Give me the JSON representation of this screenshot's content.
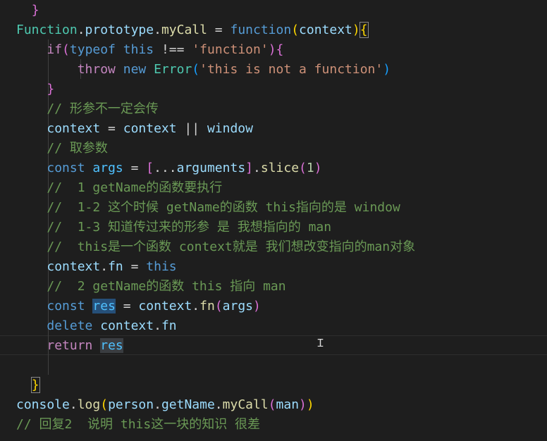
{
  "lines": [
    [
      {
        "t": "  ",
        "c": "op"
      },
      {
        "t": "}",
        "c": "b2"
      }
    ],
    [
      {
        "t": "Function",
        "c": "t"
      },
      {
        "t": ".",
        "c": "op"
      },
      {
        "t": "prototype",
        "c": "v"
      },
      {
        "t": ".",
        "c": "op"
      },
      {
        "t": "myCall",
        "c": "f"
      },
      {
        "t": " = ",
        "c": "op"
      },
      {
        "t": "function",
        "c": "k"
      },
      {
        "t": "(",
        "c": "b1"
      },
      {
        "t": "context",
        "c": "v"
      },
      {
        "t": ")",
        "c": "b1"
      },
      {
        "t": "{",
        "c": "b1 bm"
      }
    ],
    [
      {
        "t": "    ",
        "c": "op"
      },
      {
        "t": "if",
        "c": "c"
      },
      {
        "t": "(",
        "c": "b2"
      },
      {
        "t": "typeof",
        "c": "k"
      },
      {
        "t": " ",
        "c": "op"
      },
      {
        "t": "this",
        "c": "k"
      },
      {
        "t": " !== ",
        "c": "op"
      },
      {
        "t": "'function'",
        "c": "s"
      },
      {
        "t": ")",
        "c": "b2"
      },
      {
        "t": "{",
        "c": "b2"
      }
    ],
    [
      {
        "t": "        ",
        "c": "op"
      },
      {
        "t": "throw",
        "c": "c"
      },
      {
        "t": " ",
        "c": "op"
      },
      {
        "t": "new",
        "c": "k"
      },
      {
        "t": " ",
        "c": "op"
      },
      {
        "t": "Error",
        "c": "t"
      },
      {
        "t": "(",
        "c": "b3"
      },
      {
        "t": "'this is not a function'",
        "c": "s"
      },
      {
        "t": ")",
        "c": "b3"
      }
    ],
    [
      {
        "t": "    ",
        "c": "op"
      },
      {
        "t": "}",
        "c": "b2"
      }
    ],
    [
      {
        "t": "    ",
        "c": "op"
      },
      {
        "t": "// 形参不一定会传",
        "c": "cm"
      }
    ],
    [
      {
        "t": "    ",
        "c": "op"
      },
      {
        "t": "context",
        "c": "v"
      },
      {
        "t": " = ",
        "c": "op"
      },
      {
        "t": "context",
        "c": "v"
      },
      {
        "t": " || ",
        "c": "op"
      },
      {
        "t": "window",
        "c": "v"
      }
    ],
    [
      {
        "t": "    ",
        "c": "op"
      },
      {
        "t": "// 取参数",
        "c": "cm"
      }
    ],
    [
      {
        "t": "    ",
        "c": "op"
      },
      {
        "t": "const",
        "c": "k"
      },
      {
        "t": " ",
        "c": "op"
      },
      {
        "t": "args",
        "c": "cn"
      },
      {
        "t": " = ",
        "c": "op"
      },
      {
        "t": "[",
        "c": "b2"
      },
      {
        "t": "...",
        "c": "op"
      },
      {
        "t": "arguments",
        "c": "v"
      },
      {
        "t": "]",
        "c": "b2"
      },
      {
        "t": ".",
        "c": "op"
      },
      {
        "t": "slice",
        "c": "f"
      },
      {
        "t": "(",
        "c": "b2"
      },
      {
        "t": "1",
        "c": "n"
      },
      {
        "t": ")",
        "c": "b2"
      }
    ],
    [
      {
        "t": "    ",
        "c": "op"
      },
      {
        "t": "//  1 getName的函数要执行",
        "c": "cm"
      }
    ],
    [
      {
        "t": "    ",
        "c": "op"
      },
      {
        "t": "//  1-2 这个时候 getName的函数 this指向的是 window",
        "c": "cm"
      }
    ],
    [
      {
        "t": "    ",
        "c": "op"
      },
      {
        "t": "//  1-3 知道传过来的形参 是 我想指向的 man",
        "c": "cm"
      }
    ],
    [
      {
        "t": "    ",
        "c": "op"
      },
      {
        "t": "//  this是一个函数 context就是 我们想改变指向的man对象",
        "c": "cm"
      }
    ],
    [
      {
        "t": "    ",
        "c": "op"
      },
      {
        "t": "context",
        "c": "v"
      },
      {
        "t": ".",
        "c": "op"
      },
      {
        "t": "fn",
        "c": "v"
      },
      {
        "t": " = ",
        "c": "op"
      },
      {
        "t": "this",
        "c": "k"
      }
    ],
    [
      {
        "t": "    ",
        "c": "op"
      },
      {
        "t": "//  2 getName的函数 this 指向 man",
        "c": "cm"
      }
    ],
    [
      {
        "t": "    ",
        "c": "op"
      },
      {
        "t": "const",
        "c": "k"
      },
      {
        "t": " ",
        "c": "op"
      },
      {
        "t": "res",
        "c": "cn hl"
      },
      {
        "t": " = ",
        "c": "op"
      },
      {
        "t": "context",
        "c": "v"
      },
      {
        "t": ".",
        "c": "op"
      },
      {
        "t": "fn",
        "c": "f"
      },
      {
        "t": "(",
        "c": "b2"
      },
      {
        "t": "args",
        "c": "v"
      },
      {
        "t": ")",
        "c": "b2"
      }
    ],
    [
      {
        "t": "    ",
        "c": "op"
      },
      {
        "t": "delete",
        "c": "k"
      },
      {
        "t": " ",
        "c": "op"
      },
      {
        "t": "context",
        "c": "v"
      },
      {
        "t": ".",
        "c": "op"
      },
      {
        "t": "fn",
        "c": "v"
      }
    ],
    [
      {
        "t": "    ",
        "c": "op"
      },
      {
        "t": "return",
        "c": "c"
      },
      {
        "t": " ",
        "c": "op"
      },
      {
        "t": "res",
        "c": "cn hl2"
      }
    ],
    [],
    [
      {
        "t": "  ",
        "c": "op"
      },
      {
        "t": "}",
        "c": "b1 bm"
      }
    ],
    [
      {
        "t": "console",
        "c": "v"
      },
      {
        "t": ".",
        "c": "op"
      },
      {
        "t": "log",
        "c": "f"
      },
      {
        "t": "(",
        "c": "b1"
      },
      {
        "t": "person",
        "c": "v"
      },
      {
        "t": ".",
        "c": "op"
      },
      {
        "t": "getName",
        "c": "v"
      },
      {
        "t": ".",
        "c": "op"
      },
      {
        "t": "myCall",
        "c": "f"
      },
      {
        "t": "(",
        "c": "b2"
      },
      {
        "t": "man",
        "c": "v"
      },
      {
        "t": ")",
        "c": "b2"
      },
      {
        "t": ")",
        "c": "b1"
      }
    ],
    [
      {
        "t": "// 回复2  说明 this这一块的知识 很差",
        "c": "cm"
      }
    ]
  ],
  "cursor_icon": "text-cursor-icon"
}
